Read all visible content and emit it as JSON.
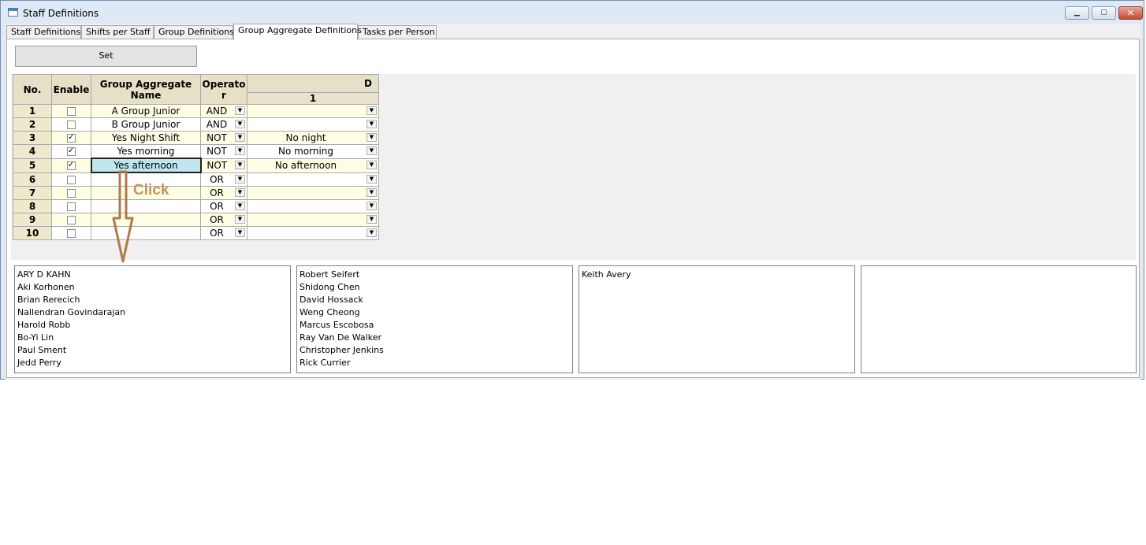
{
  "window": {
    "title": "Staff Definitions",
    "minimize": "▁",
    "maximize": "▢",
    "close": "✕"
  },
  "tabs": [
    {
      "label": "Staff Definitions",
      "active": false
    },
    {
      "label": "Shifts per Staff",
      "active": false
    },
    {
      "label": "Group Definitions",
      "active": false
    },
    {
      "label": "Group Aggregate Definitions",
      "active": true
    },
    {
      "label": "Tasks per Person",
      "active": false
    }
  ],
  "toolbar": {
    "set_label": "Set"
  },
  "grid": {
    "headers": {
      "no": "No.",
      "enable": "Enable",
      "group_name": "Group Aggregate Name",
      "operator": "Operator",
      "d": "D",
      "d_sub": "1"
    },
    "rows": [
      {
        "no": "1",
        "enabled": false,
        "name": "A Group Junior",
        "operator": "AND",
        "d1": ""
      },
      {
        "no": "2",
        "enabled": false,
        "name": "B Group Junior",
        "operator": "AND",
        "d1": ""
      },
      {
        "no": "3",
        "enabled": true,
        "name": "Yes Night Shift",
        "operator": "NOT",
        "d1": "No night"
      },
      {
        "no": "4",
        "enabled": true,
        "name": "Yes morning",
        "operator": "NOT",
        "d1": "No morning"
      },
      {
        "no": "5",
        "enabled": true,
        "name": "Yes afternoon",
        "operator": "NOT",
        "d1": "No afternoon",
        "selected": true
      },
      {
        "no": "6",
        "enabled": false,
        "name": "",
        "operator": "OR",
        "d1": ""
      },
      {
        "no": "7",
        "enabled": false,
        "name": "",
        "operator": "OR",
        "d1": ""
      },
      {
        "no": "8",
        "enabled": false,
        "name": "",
        "operator": "OR",
        "d1": ""
      },
      {
        "no": "9",
        "enabled": false,
        "name": "",
        "operator": "OR",
        "d1": ""
      },
      {
        "no": "10",
        "enabled": false,
        "name": "",
        "operator": "OR",
        "d1": ""
      }
    ]
  },
  "annotation": {
    "label": "Click",
    "color": "#b07a4c"
  },
  "lists": [
    {
      "items": [
        "ARY D KAHN",
        "Aki Korhonen",
        "Brian Rerecich",
        "Nallendran Govindarajan",
        "Harold Robb",
        "Bo-Yi Lin",
        "Paul Sment",
        "Jedd Perry"
      ]
    },
    {
      "items": [
        "Robert Seifert",
        "Shidong Chen",
        "David Hossack",
        "Weng Cheong",
        "Marcus Escobosa",
        "Ray Van De Walker",
        "Christopher Jenkins",
        "Rick Currier"
      ]
    },
    {
      "items": [
        "Keith Avery"
      ]
    },
    {
      "items": []
    }
  ]
}
